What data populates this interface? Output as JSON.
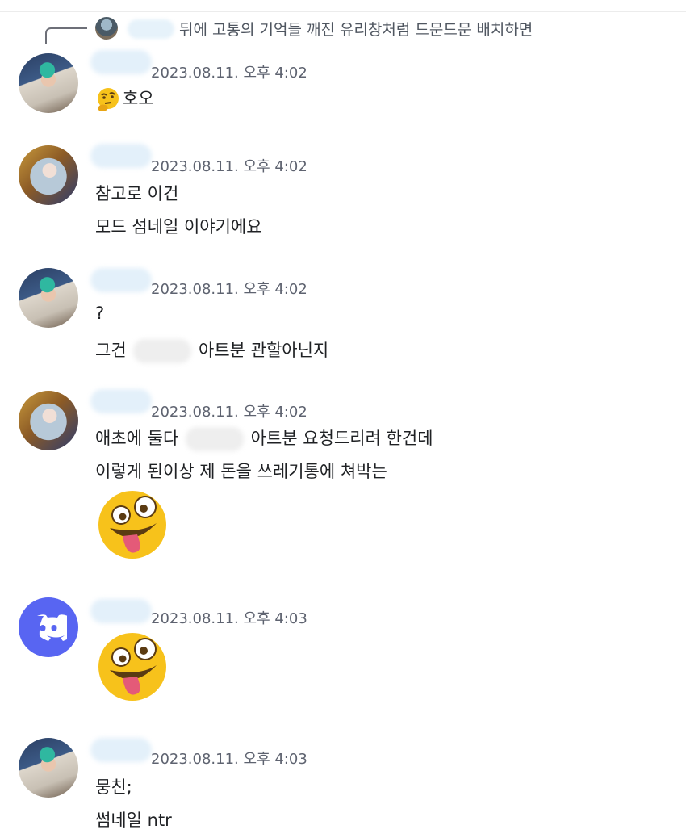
{
  "reply": {
    "text": "뒤에 고통의 기억들 깨진 유리창처럼 드문드문 배치하면"
  },
  "messages": [
    {
      "timestamp": "2023.08.11. 오후 4:02",
      "line1": "호오"
    },
    {
      "timestamp": "2023.08.11. 오후 4:02",
      "line1": "참고로 이건",
      "line2": "모드 섬네일 이야기에요"
    },
    {
      "timestamp": "2023.08.11. 오후 4:02",
      "line1": "?",
      "line2_before": "그건",
      "line2_after": "아트분 관할아닌지"
    },
    {
      "timestamp": "2023.08.11. 오후 4:02",
      "line1_before": "애초에 둘다",
      "line1_after": "아트분 요청드리려 한건데",
      "line2": "이렇게 된이상 제 돈을 쓰레기통에 쳐박는"
    },
    {
      "timestamp": "2023.08.11. 오후 4:03"
    },
    {
      "timestamp": "2023.08.11. 오후 4:03",
      "line1": "뭉친;",
      "line2": "썸네일 ntr"
    }
  ],
  "icons": {
    "reply_spine": "reply-spine-icon",
    "thinking": "thinking-face-emoji",
    "zany": "zany-face-emoji",
    "discord": "discord-logo"
  },
  "colors": {
    "timestamp": "#5e6370",
    "discord": "#5865f2",
    "emoji": "#f7c21b"
  }
}
